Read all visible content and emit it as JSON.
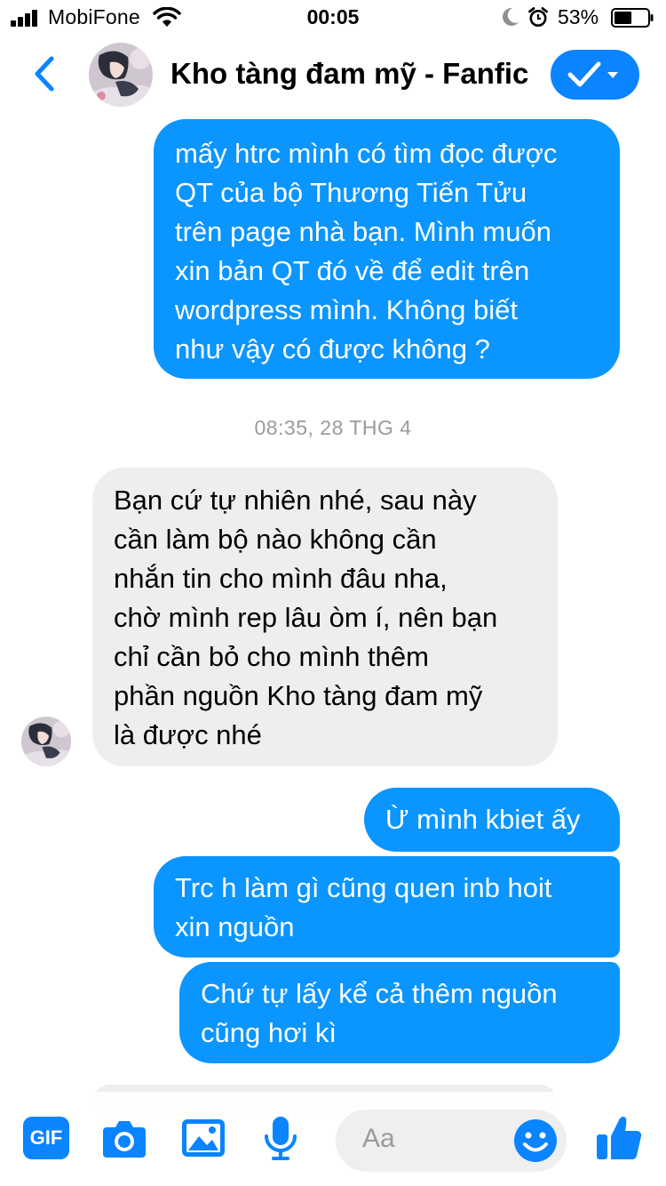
{
  "status_bar": {
    "carrier": "MobiFone",
    "time": "00:05",
    "battery_percent": "53%",
    "battery_level": 0.53
  },
  "header": {
    "title": "Kho tàng đam mỹ - Fanfic",
    "accent_color": "#0a84ff"
  },
  "messages": [
    {
      "direction": "out",
      "text": "mấy htrc mình có tìm đọc được\nQT của bộ Thương Tiến Tửu\ntrên page nhà bạn. Mình muốn\nxin bản QT đó về để edit trên\nwordpress mình. Không biết\nnhư vậy có được không ?"
    },
    {
      "direction": "in",
      "text": "Bạn cứ tự nhiên nhé, sau này\ncần làm bộ nào không cần\nnhắn tin cho mình đâu nha,\nchờ mình rep lâu òm í, nên bạn\nchỉ cần bỏ cho mình thêm\nphần nguồn Kho tàng đam mỹ\nlà được nhé"
    },
    {
      "direction": "out",
      "text": "Ừ mình kbiet ấy"
    },
    {
      "direction": "out",
      "text": "Trc h làm gì cũng quen inb hoit\nxin nguồn"
    },
    {
      "direction": "out",
      "text": "Chứ tự lấy kể cả thêm nguồn\ncũng hơi kì"
    }
  ],
  "timestamp": "08:35, 28 THG 4",
  "composer": {
    "gif_label": "GIF",
    "placeholder": "Aa",
    "icons": [
      "gif-icon",
      "camera-icon",
      "photo-icon",
      "microphone-icon",
      "emoji-icon",
      "like-icon"
    ]
  },
  "colors": {
    "outgoing_bubble": "#0a95ff",
    "incoming_bubble": "#eeeeee",
    "timestamp_text": "#9b9b9b"
  }
}
